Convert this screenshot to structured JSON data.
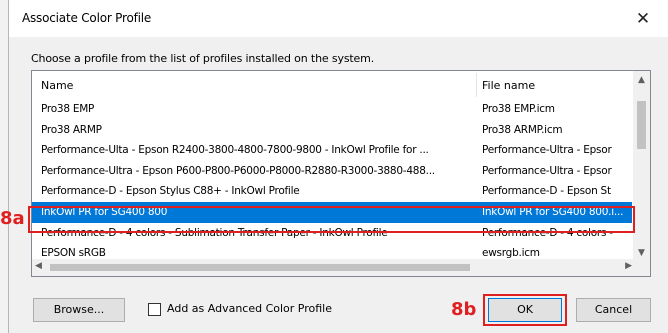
{
  "dialog": {
    "title": "Associate Color Profile",
    "close_glyph": "✕",
    "instruction": "Choose a profile from the list of profiles installed on the system."
  },
  "list": {
    "columns": {
      "name": "Name",
      "file": "File name"
    },
    "rows": [
      {
        "name": "Pro38 EMP",
        "file": "Pro38 EMP.icm",
        "selected": false
      },
      {
        "name": "Pro38 ARMP",
        "file": "Pro38 ARMP.icm",
        "selected": false
      },
      {
        "name": "Performance-Ulta - Epson R2400-3800-4800-7800-9800 - InkOwl Profile for ...",
        "file": "Performance-Ultra - Epsor",
        "selected": false
      },
      {
        "name": "Performance-Ultra - Epson P600-P800-P6000-P8000-R2880-R3000-3880-488...",
        "file": "Performance-Ultra - Epsor",
        "selected": false
      },
      {
        "name": "Performance-D - Epson Stylus C88+ - InkOwl Profile",
        "file": "Performance-D - Epson St",
        "selected": false
      },
      {
        "name": "InkOwl PR for SG400 800",
        "file": "InkOwl PR for SG400 800.i...",
        "selected": true
      },
      {
        "name": "Performance-D - 4 colors - Sublimation Transfer Paper - InkOwl Profile",
        "file": "Performance-D - 4 colors -",
        "selected": false
      },
      {
        "name": "EPSON  sRGB",
        "file": "ewsrgb.icm",
        "selected": false
      }
    ]
  },
  "buttons": {
    "browse": "Browse...",
    "ok": "OK",
    "cancel": "Cancel"
  },
  "checkbox": {
    "label": "Add as Advanced Color Profile",
    "checked": false
  },
  "annotations": {
    "a": "8a",
    "b": "8b",
    "color": "#e02020"
  },
  "colors": {
    "selection": "#0078d7"
  }
}
